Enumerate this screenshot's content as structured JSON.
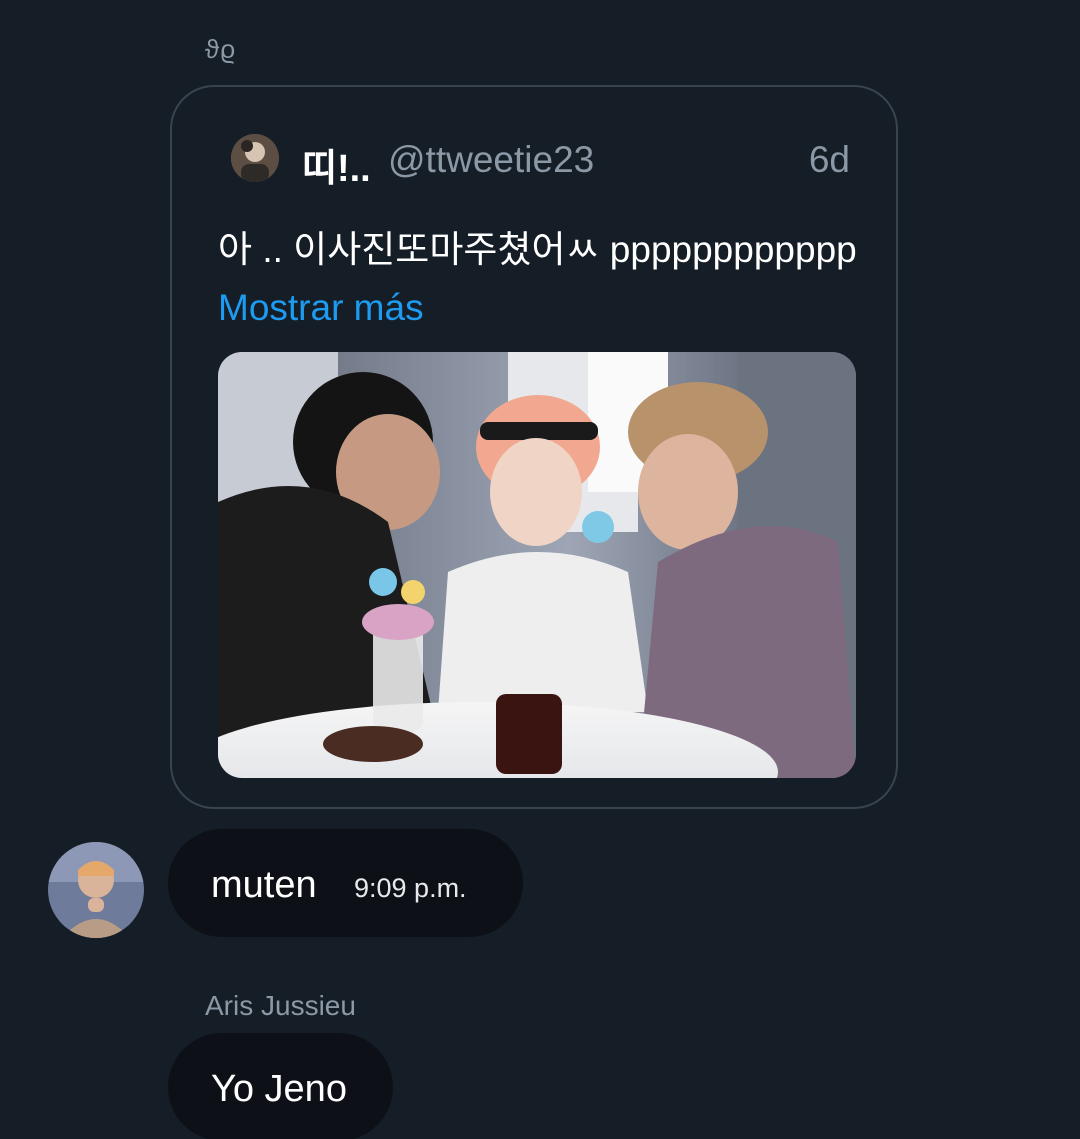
{
  "conversation": {
    "top_sender": "ϑϱ",
    "quote": {
      "author_name": "띠!..",
      "author_handle": "@ttweetie23",
      "age": "6d",
      "text": "아 .. 이사진또마주쳤어ㅆ pppppppppppp",
      "show_more": "Mostrar más",
      "avatar_icon": "user-avatar-icon",
      "media_icon": "photo-icon"
    },
    "messages": [
      {
        "text": "muten",
        "time": "9:09 p.m.",
        "avatar_icon": "user-avatar-icon"
      },
      {
        "sender": "Aris Jussieu",
        "text": "Yo Jeno"
      }
    ]
  },
  "colors": {
    "background": "#151d27",
    "bubble": "#0d1117",
    "link": "#1d9bf0",
    "muted": "#8b98a5",
    "card_border": "#39444f"
  }
}
